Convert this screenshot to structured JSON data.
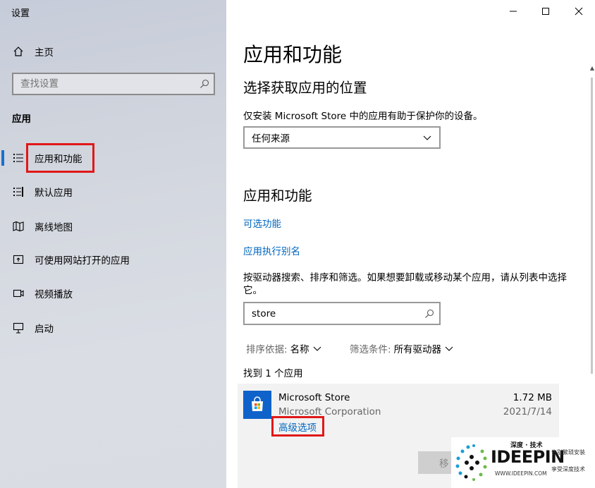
{
  "window": {
    "title": "设置"
  },
  "sidebar": {
    "home_label": "主页",
    "search_placeholder": "查找设置",
    "section_heading": "应用",
    "items": [
      {
        "label": "应用和功能",
        "icon": "apps-features-icon",
        "active": true
      },
      {
        "label": "默认应用",
        "icon": "default-apps-icon"
      },
      {
        "label": "离线地图",
        "icon": "offline-maps-icon"
      },
      {
        "label": "可使用网站打开的应用",
        "icon": "apps-for-websites-icon"
      },
      {
        "label": "视频播放",
        "icon": "video-playback-icon"
      },
      {
        "label": "启动",
        "icon": "startup-icon"
      }
    ]
  },
  "main": {
    "title": "应用和功能",
    "location_heading": "选择获取应用的位置",
    "location_desc": "仅安装 Microsoft Store 中的应用有助于保护你的设备。",
    "source_value": "任何来源",
    "apps_heading": "应用和功能",
    "link_optional": "可选功能",
    "link_alias": "应用执行别名",
    "search_desc": "按驱动器搜索、排序和筛选。如果想要卸载或移动某个应用，请从列表中选择它。",
    "search_value": "store",
    "sort_label": "排序依据:",
    "sort_value": "名称",
    "filter_label": "筛选条件:",
    "filter_value": "所有驱动器",
    "found_text": "找到 1 个应用",
    "app": {
      "name": "Microsoft Store",
      "publisher": "Microsoft Corporation",
      "size": "1.72 MB",
      "date": "2021/7/14",
      "advanced_link": "高级选项",
      "move_button": "移"
    }
  },
  "watermark": {
    "top": "深度 · 技术",
    "brand": "IDEEPIN",
    "url": "WWW.IDEEPIN.COM",
    "tagline1": "告别繁琐安装",
    "tagline2": "享受深度技术"
  },
  "colors": {
    "accent": "#0067c0",
    "highlight": "#e01818",
    "active_bar": "#1a6fd1"
  }
}
